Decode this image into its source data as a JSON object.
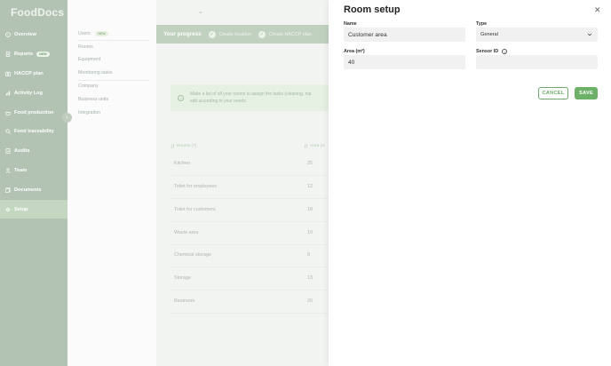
{
  "app": {
    "logo": "FoodDocs"
  },
  "sidebar": {
    "items": [
      {
        "label": "Overview",
        "icon": "compass-icon"
      },
      {
        "label": "Reports",
        "icon": "reports-icon",
        "badge": "NEW"
      },
      {
        "label": "HACCP plan",
        "icon": "book-icon"
      },
      {
        "label": "Activity Log",
        "icon": "chart-icon"
      },
      {
        "label": "Food production",
        "icon": "pot-icon"
      },
      {
        "label": "Food traceability",
        "icon": "search-icon"
      },
      {
        "label": "Audits",
        "icon": "checklist-icon"
      },
      {
        "label": "Team",
        "icon": "person-icon"
      },
      {
        "label": "Documents",
        "icon": "documents-icon"
      },
      {
        "label": "Setup",
        "icon": "gear-icon",
        "active": true
      }
    ]
  },
  "submenu": {
    "items": [
      {
        "label": "Users",
        "badge": "NEW"
      },
      {
        "label": "Rooms"
      },
      {
        "label": "Equipment"
      },
      {
        "label": "Monitoring tasks"
      },
      {
        "label": "Company"
      },
      {
        "label": "Business units"
      },
      {
        "label": "Integration"
      }
    ]
  },
  "progress": {
    "title": "Your progress",
    "steps": [
      "Create location",
      "Create HACCP plan"
    ]
  },
  "info": {
    "text_line1": "Make a list of all your rooms to assign the tasks (cleaning, ma",
    "text_line2": "edit according to your needs."
  },
  "table": {
    "headers": {
      "rooms": "Rooms (7)",
      "area": "Area (m"
    },
    "rows": [
      {
        "name": "Kitchen",
        "area": "25"
      },
      {
        "name": "Toilet for employees",
        "area": "12"
      },
      {
        "name": "Toilet for customers",
        "area": "18"
      },
      {
        "name": "Waste area",
        "area": "10"
      },
      {
        "name": "Chemical storage",
        "area": "8"
      },
      {
        "name": "Storage",
        "area": "13"
      },
      {
        "name": "Restroom",
        "area": "20"
      }
    ]
  },
  "panel": {
    "title": "Room setup",
    "name_label": "Name",
    "name_value": "Customer area",
    "type_label": "Type",
    "type_value": "General",
    "area_label": "Area (m²)",
    "area_value": "40",
    "sensor_label": "Sensor ID",
    "sensor_value": "",
    "cancel_label": "CANCEL",
    "save_label": "SAVE"
  },
  "colors": {
    "brand_green": "#6db067",
    "sidebar_bg": "#a8bba9",
    "info_bg": "#e3eee0"
  }
}
